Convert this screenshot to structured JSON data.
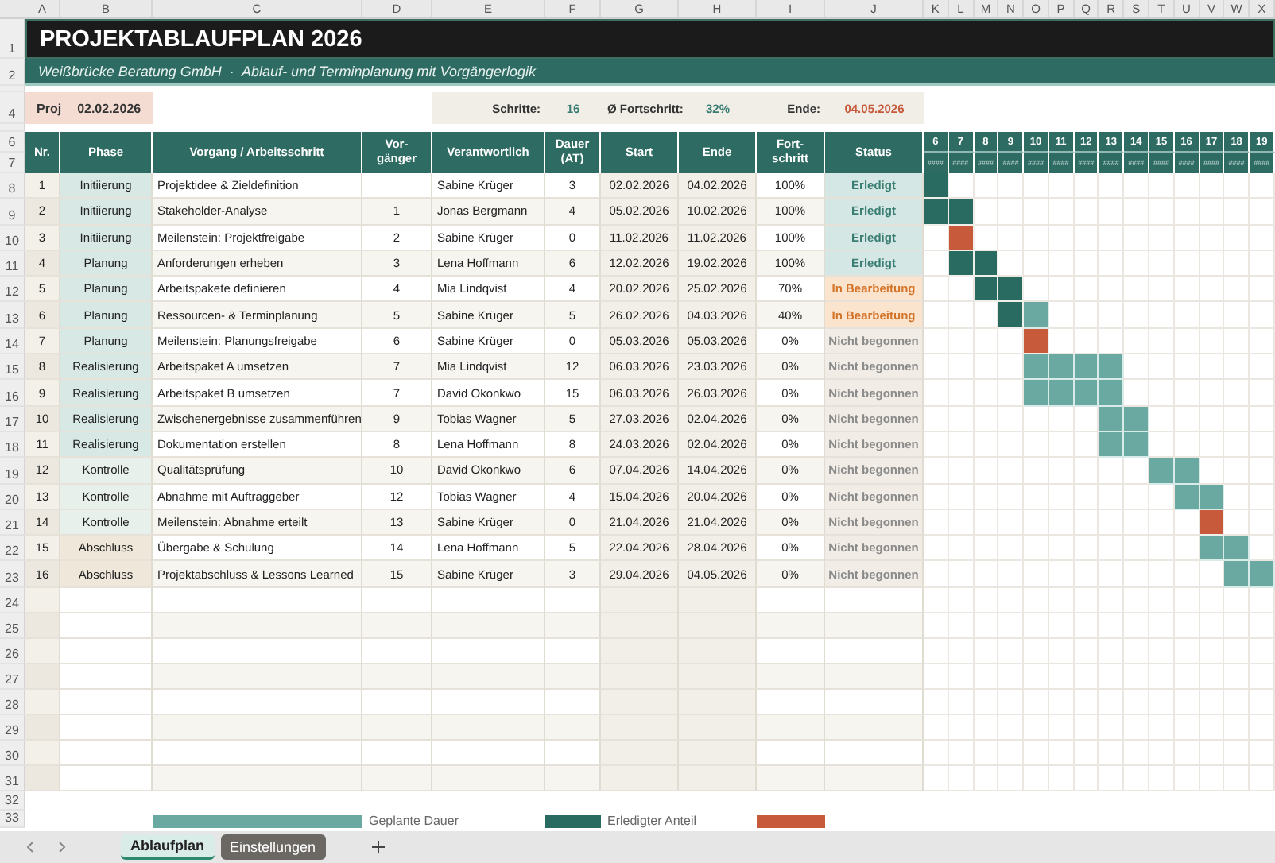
{
  "column_letters": [
    "A",
    "B",
    "C",
    "D",
    "E",
    "F",
    "G",
    "H",
    "I",
    "J",
    "K",
    "L",
    "M",
    "N",
    "O",
    "P",
    "Q",
    "R",
    "S",
    "T",
    "U",
    "V",
    "W",
    "X"
  ],
  "title": {
    "row_label": "1",
    "text": "PROJEKTABLAUFPLAN 2026"
  },
  "subtitle": {
    "row_label": "2",
    "text": "Weißbrücke Beratung GmbH  ·  Ablauf- und Terminplanung mit Vorgängerlogik"
  },
  "info_row": {
    "row_label": "4",
    "project_start": {
      "label": "Proj",
      "value": "02.02.2026"
    },
    "summary": [
      {
        "label": "Schritte:",
        "value": "16",
        "kind": "plain"
      },
      {
        "label": "Ø Fortschritt:",
        "value": "32%",
        "kind": "plain"
      },
      {
        "label": "Ende:",
        "value": "04.05.2026",
        "kind": "accent"
      }
    ]
  },
  "table": {
    "header_row_labels": [
      "6",
      "7"
    ],
    "columns": [
      "Nr.",
      "Phase",
      "Vorgang / Arbeitsschritt",
      "Vor-\ngänger",
      "Verantwortlich",
      "Dauer\n(AT)",
      "Start",
      "Ende",
      "Fort-\nschritt",
      "Status"
    ],
    "weeks": [
      {
        "number": "6",
        "date": "####"
      },
      {
        "number": "7",
        "date": "####"
      },
      {
        "number": "8",
        "date": "####"
      },
      {
        "number": "9",
        "date": "####"
      },
      {
        "number": "10",
        "date": "####"
      },
      {
        "number": "11",
        "date": "####"
      },
      {
        "number": "12",
        "date": "####"
      },
      {
        "number": "13",
        "date": "####"
      },
      {
        "number": "14",
        "date": "####"
      },
      {
        "number": "15",
        "date": "####"
      },
      {
        "number": "16",
        "date": "####"
      },
      {
        "number": "17",
        "date": "####"
      },
      {
        "number": "18",
        "date": "####"
      },
      {
        "number": "19",
        "date": "####"
      }
    ],
    "rows": [
      {
        "row_label": "8",
        "nr": "1",
        "phase": "Initiierung",
        "color": "#d8e8e5",
        "task": "Projektidee & Zieldefinition",
        "owner": "Sabine Krüger",
        "duration": "3",
        "start": "02.02.2026",
        "end": "04.02.2026",
        "progress": "100%",
        "status": "Erledigt",
        "kind": "done",
        "gantt": [
          {
            "kind": "done"
          },
          {
            "kind": "none"
          },
          {
            "kind": "none"
          },
          {
            "kind": "none"
          },
          {
            "kind": "none"
          },
          {
            "kind": "none"
          },
          {
            "kind": "none"
          },
          {
            "kind": "none"
          },
          {
            "kind": "none"
          },
          {
            "kind": "none"
          },
          {
            "kind": "none"
          },
          {
            "kind": "none"
          },
          {
            "kind": "none"
          },
          {
            "kind": "none"
          }
        ]
      },
      {
        "row_label": "9",
        "nr": "2",
        "phase": "Initiierung",
        "color": "#d8e8e5",
        "task": "Stakeholder-Analyse",
        "predecessor": "1",
        "owner": "Jonas Bergmann",
        "duration": "4",
        "start": "05.02.2026",
        "end": "10.02.2026",
        "progress": "100%",
        "status": "Erledigt",
        "kind": "done",
        "gantt": [
          {
            "kind": "done"
          },
          {
            "kind": "done"
          },
          {
            "kind": "none"
          },
          {
            "kind": "none"
          },
          {
            "kind": "none"
          },
          {
            "kind": "none"
          },
          {
            "kind": "none"
          },
          {
            "kind": "none"
          },
          {
            "kind": "none"
          },
          {
            "kind": "none"
          },
          {
            "kind": "none"
          },
          {
            "kind": "none"
          },
          {
            "kind": "none"
          },
          {
            "kind": "none"
          }
        ]
      },
      {
        "row_label": "10",
        "nr": "3",
        "phase": "Initiierung",
        "color": "#d8e8e5",
        "task": "Meilenstein: Projektfreigabe",
        "predecessor": "2",
        "owner": "Sabine Krüger",
        "duration": "0",
        "start": "11.02.2026",
        "end": "11.02.2026",
        "progress": "100%",
        "status": "Erledigt",
        "kind": "done",
        "gantt": [
          {
            "kind": "none"
          },
          {
            "kind": "milestone"
          },
          {
            "kind": "none"
          },
          {
            "kind": "none"
          },
          {
            "kind": "none"
          },
          {
            "kind": "none"
          },
          {
            "kind": "none"
          },
          {
            "kind": "none"
          },
          {
            "kind": "none"
          },
          {
            "kind": "none"
          },
          {
            "kind": "none"
          },
          {
            "kind": "none"
          },
          {
            "kind": "none"
          },
          {
            "kind": "none"
          }
        ]
      },
      {
        "row_label": "11",
        "nr": "4",
        "phase": "Planung",
        "color": "#d8e8e5",
        "task": "Anforderungen erheben",
        "predecessor": "3",
        "owner": "Lena Hoffmann",
        "duration": "6",
        "start": "12.02.2026",
        "end": "19.02.2026",
        "progress": "100%",
        "status": "Erledigt",
        "kind": "done",
        "gantt": [
          {
            "kind": "none"
          },
          {
            "kind": "done"
          },
          {
            "kind": "done"
          },
          {
            "kind": "none"
          },
          {
            "kind": "none"
          },
          {
            "kind": "none"
          },
          {
            "kind": "none"
          },
          {
            "kind": "none"
          },
          {
            "kind": "none"
          },
          {
            "kind": "none"
          },
          {
            "kind": "none"
          },
          {
            "kind": "none"
          },
          {
            "kind": "none"
          },
          {
            "kind": "none"
          }
        ]
      },
      {
        "row_label": "12",
        "nr": "5",
        "phase": "Planung",
        "color": "#d8e8e5",
        "task": "Arbeitspakete definieren",
        "predecessor": "4",
        "owner": "Mia Lindqvist",
        "duration": "4",
        "start": "20.02.2026",
        "end": "25.02.2026",
        "progress": "70%",
        "status": "In Bearbeitung",
        "kind": "in_progress",
        "gantt": [
          {
            "kind": "none"
          },
          {
            "kind": "none"
          },
          {
            "kind": "done"
          },
          {
            "kind": "done"
          },
          {
            "kind": "none"
          },
          {
            "kind": "none"
          },
          {
            "kind": "none"
          },
          {
            "kind": "none"
          },
          {
            "kind": "none"
          },
          {
            "kind": "none"
          },
          {
            "kind": "none"
          },
          {
            "kind": "none"
          },
          {
            "kind": "none"
          },
          {
            "kind": "none"
          }
        ]
      },
      {
        "row_label": "13",
        "nr": "6",
        "phase": "Planung",
        "color": "#d8e8e5",
        "task": "Ressourcen- & Terminplanung",
        "predecessor": "5",
        "owner": "Sabine Krüger",
        "duration": "5",
        "start": "26.02.2026",
        "end": "04.03.2026",
        "progress": "40%",
        "status": "In Bearbeitung",
        "kind": "in_progress",
        "gantt": [
          {
            "kind": "none"
          },
          {
            "kind": "none"
          },
          {
            "kind": "none"
          },
          {
            "kind": "done"
          },
          {
            "kind": "planned"
          },
          {
            "kind": "none"
          },
          {
            "kind": "none"
          },
          {
            "kind": "none"
          },
          {
            "kind": "none"
          },
          {
            "kind": "none"
          },
          {
            "kind": "none"
          },
          {
            "kind": "none"
          },
          {
            "kind": "none"
          },
          {
            "kind": "none"
          }
        ]
      },
      {
        "row_label": "14",
        "nr": "7",
        "phase": "Planung",
        "color": "#d8e8e5",
        "task": "Meilenstein: Planungsfreigabe",
        "predecessor": "6",
        "owner": "Sabine Krüger",
        "duration": "0",
        "start": "05.03.2026",
        "end": "05.03.2026",
        "progress": "0%",
        "status": "Nicht begonnen",
        "kind": "not_started",
        "gantt": [
          {
            "kind": "none"
          },
          {
            "kind": "none"
          },
          {
            "kind": "none"
          },
          {
            "kind": "none"
          },
          {
            "kind": "milestone"
          },
          {
            "kind": "none"
          },
          {
            "kind": "none"
          },
          {
            "kind": "none"
          },
          {
            "kind": "none"
          },
          {
            "kind": "none"
          },
          {
            "kind": "none"
          },
          {
            "kind": "none"
          },
          {
            "kind": "none"
          },
          {
            "kind": "none"
          }
        ]
      },
      {
        "row_label": "15",
        "nr": "8",
        "phase": "Realisierung",
        "color": "#d8e8e5",
        "task": "Arbeitspaket A umsetzen",
        "predecessor": "7",
        "owner": "Mia Lindqvist",
        "duration": "12",
        "start": "06.03.2026",
        "end": "23.03.2026",
        "progress": "0%",
        "status": "Nicht begonnen",
        "kind": "not_started",
        "gantt": [
          {
            "kind": "none"
          },
          {
            "kind": "none"
          },
          {
            "kind": "none"
          },
          {
            "kind": "none"
          },
          {
            "kind": "planned"
          },
          {
            "kind": "planned"
          },
          {
            "kind": "planned"
          },
          {
            "kind": "planned"
          },
          {
            "kind": "none"
          },
          {
            "kind": "none"
          },
          {
            "kind": "none"
          },
          {
            "kind": "none"
          },
          {
            "kind": "none"
          },
          {
            "kind": "none"
          }
        ]
      },
      {
        "row_label": "16",
        "nr": "9",
        "phase": "Realisierung",
        "color": "#d8e8e5",
        "task": "Arbeitspaket B umsetzen",
        "predecessor": "7",
        "owner": "David Okonkwo",
        "duration": "15",
        "start": "06.03.2026",
        "end": "26.03.2026",
        "progress": "0%",
        "status": "Nicht begonnen",
        "kind": "not_started",
        "gantt": [
          {
            "kind": "none"
          },
          {
            "kind": "none"
          },
          {
            "kind": "none"
          },
          {
            "kind": "none"
          },
          {
            "kind": "planned"
          },
          {
            "kind": "planned"
          },
          {
            "kind": "planned"
          },
          {
            "kind": "planned"
          },
          {
            "kind": "none"
          },
          {
            "kind": "none"
          },
          {
            "kind": "none"
          },
          {
            "kind": "none"
          },
          {
            "kind": "none"
          },
          {
            "kind": "none"
          }
        ]
      },
      {
        "row_label": "17",
        "nr": "10",
        "phase": "Realisierung",
        "color": "#d8e8e5",
        "task": "Zwischenergebnisse zusammenführen",
        "predecessor": "9",
        "owner": "Tobias Wagner",
        "duration": "5",
        "start": "27.03.2026",
        "end": "02.04.2026",
        "progress": "0%",
        "status": "Nicht begonnen",
        "kind": "not_started",
        "gantt": [
          {
            "kind": "none"
          },
          {
            "kind": "none"
          },
          {
            "kind": "none"
          },
          {
            "kind": "none"
          },
          {
            "kind": "none"
          },
          {
            "kind": "none"
          },
          {
            "kind": "none"
          },
          {
            "kind": "planned"
          },
          {
            "kind": "planned"
          },
          {
            "kind": "none"
          },
          {
            "kind": "none"
          },
          {
            "kind": "none"
          },
          {
            "kind": "none"
          },
          {
            "kind": "none"
          }
        ]
      },
      {
        "row_label": "18",
        "nr": "11",
        "phase": "Realisierung",
        "color": "#d8e8e5",
        "task": "Dokumentation erstellen",
        "predecessor": "8",
        "owner": "Lena Hoffmann",
        "duration": "8",
        "start": "24.03.2026",
        "end": "02.04.2026",
        "progress": "0%",
        "status": "Nicht begonnen",
        "kind": "not_started",
        "gantt": [
          {
            "kind": "none"
          },
          {
            "kind": "none"
          },
          {
            "kind": "none"
          },
          {
            "kind": "none"
          },
          {
            "kind": "none"
          },
          {
            "kind": "none"
          },
          {
            "kind": "none"
          },
          {
            "kind": "planned"
          },
          {
            "kind": "planned"
          },
          {
            "kind": "none"
          },
          {
            "kind": "none"
          },
          {
            "kind": "none"
          },
          {
            "kind": "none"
          },
          {
            "kind": "none"
          }
        ]
      },
      {
        "row_label": "19",
        "nr": "12",
        "phase": "Kontrolle",
        "color": "#e7f0ea",
        "task": "Qualitätsprüfung",
        "predecessor": "10",
        "owner": "David Okonkwo",
        "duration": "6",
        "start": "07.04.2026",
        "end": "14.04.2026",
        "progress": "0%",
        "status": "Nicht begonnen",
        "kind": "not_started",
        "gantt": [
          {
            "kind": "none"
          },
          {
            "kind": "none"
          },
          {
            "kind": "none"
          },
          {
            "kind": "none"
          },
          {
            "kind": "none"
          },
          {
            "kind": "none"
          },
          {
            "kind": "none"
          },
          {
            "kind": "none"
          },
          {
            "kind": "none"
          },
          {
            "kind": "planned"
          },
          {
            "kind": "planned"
          },
          {
            "kind": "none"
          },
          {
            "kind": "none"
          },
          {
            "kind": "none"
          }
        ]
      },
      {
        "row_label": "20",
        "nr": "13",
        "phase": "Kontrolle",
        "color": "#e7f0ea",
        "task": "Abnahme mit Auftraggeber",
        "predecessor": "12",
        "owner": "Tobias Wagner",
        "duration": "4",
        "start": "15.04.2026",
        "end": "20.04.2026",
        "progress": "0%",
        "status": "Nicht begonnen",
        "kind": "not_started",
        "gantt": [
          {
            "kind": "none"
          },
          {
            "kind": "none"
          },
          {
            "kind": "none"
          },
          {
            "kind": "none"
          },
          {
            "kind": "none"
          },
          {
            "kind": "none"
          },
          {
            "kind": "none"
          },
          {
            "kind": "none"
          },
          {
            "kind": "none"
          },
          {
            "kind": "none"
          },
          {
            "kind": "planned"
          },
          {
            "kind": "planned"
          },
          {
            "kind": "none"
          },
          {
            "kind": "none"
          }
        ]
      },
      {
        "row_label": "21",
        "nr": "14",
        "phase": "Kontrolle",
        "color": "#e7f0ea",
        "task": "Meilenstein: Abnahme erteilt",
        "predecessor": "13",
        "owner": "Sabine Krüger",
        "duration": "0",
        "start": "21.04.2026",
        "end": "21.04.2026",
        "progress": "0%",
        "status": "Nicht begonnen",
        "kind": "not_started",
        "gantt": [
          {
            "kind": "none"
          },
          {
            "kind": "none"
          },
          {
            "kind": "none"
          },
          {
            "kind": "none"
          },
          {
            "kind": "none"
          },
          {
            "kind": "none"
          },
          {
            "kind": "none"
          },
          {
            "kind": "none"
          },
          {
            "kind": "none"
          },
          {
            "kind": "none"
          },
          {
            "kind": "none"
          },
          {
            "kind": "milestone"
          },
          {
            "kind": "none"
          },
          {
            "kind": "none"
          }
        ]
      },
      {
        "row_label": "22",
        "nr": "15",
        "phase": "Abschluss",
        "color": "#efe8da",
        "task": "Übergabe & Schulung",
        "predecessor": "14",
        "owner": "Lena Hoffmann",
        "duration": "5",
        "start": "22.04.2026",
        "end": "28.04.2026",
        "progress": "0%",
        "status": "Nicht begonnen",
        "kind": "not_started",
        "gantt": [
          {
            "kind": "none"
          },
          {
            "kind": "none"
          },
          {
            "kind": "none"
          },
          {
            "kind": "none"
          },
          {
            "kind": "none"
          },
          {
            "kind": "none"
          },
          {
            "kind": "none"
          },
          {
            "kind": "none"
          },
          {
            "kind": "none"
          },
          {
            "kind": "none"
          },
          {
            "kind": "none"
          },
          {
            "kind": "planned"
          },
          {
            "kind": "planned"
          },
          {
            "kind": "none"
          }
        ]
      },
      {
        "row_label": "23",
        "nr": "16",
        "phase": "Abschluss",
        "color": "#efe8da",
        "task": "Projektabschluss & Lessons Learned",
        "predecessor": "15",
        "owner": "Sabine Krüger",
        "duration": "3",
        "start": "29.04.2026",
        "end": "04.05.2026",
        "progress": "0%",
        "status": "Nicht begonnen",
        "kind": "not_started",
        "gantt": [
          {
            "kind": "none"
          },
          {
            "kind": "none"
          },
          {
            "kind": "none"
          },
          {
            "kind": "none"
          },
          {
            "kind": "none"
          },
          {
            "kind": "none"
          },
          {
            "kind": "none"
          },
          {
            "kind": "none"
          },
          {
            "kind": "none"
          },
          {
            "kind": "none"
          },
          {
            "kind": "none"
          },
          {
            "kind": "none"
          },
          {
            "kind": "planned"
          },
          {
            "kind": "planned"
          }
        ]
      }
    ],
    "empty_row_labels": [
      "24",
      "25",
      "26",
      "27",
      "28",
      "29",
      "30",
      "31"
    ]
  },
  "legend": {
    "row_labels": [
      "32",
      "33"
    ],
    "items": [
      {
        "label": "Geplante Dauer",
        "kind": "planned"
      },
      {
        "label": "Erledigter Anteil",
        "kind": "done"
      },
      {
        "kind": "milestone"
      }
    ]
  },
  "sheet_tabs": [
    {
      "label": "Ablaufplan",
      "selected": true
    },
    {
      "label": "Einstellungen",
      "selected": false
    }
  ]
}
